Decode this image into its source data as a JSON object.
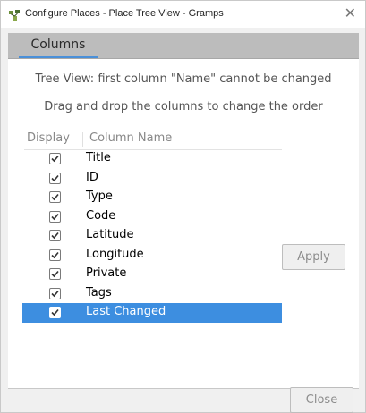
{
  "window": {
    "title": "Configure Places - Place Tree View - Gramps",
    "close_glyph": "✕"
  },
  "tabs": [
    {
      "label": "Columns"
    }
  ],
  "info": {
    "line1": "Tree View: first column \"Name\" cannot be changed",
    "line2": "Drag and drop the columns to change the order"
  },
  "table": {
    "headers": {
      "display": "Display",
      "column_name": "Column Name"
    },
    "rows": [
      {
        "name": "Title",
        "checked": true
      },
      {
        "name": "ID",
        "checked": true
      },
      {
        "name": "Type",
        "checked": true
      },
      {
        "name": "Code",
        "checked": true
      },
      {
        "name": "Latitude",
        "checked": true
      },
      {
        "name": "Longitude",
        "checked": true
      },
      {
        "name": "Private",
        "checked": true
      },
      {
        "name": "Tags",
        "checked": true
      },
      {
        "name": "Last Changed",
        "checked": true,
        "selected": true
      }
    ]
  },
  "buttons": {
    "apply": "Apply",
    "close": "Close"
  },
  "colors": {
    "selection": "#3d8ee0",
    "tab_underline": "#4a90d9"
  }
}
